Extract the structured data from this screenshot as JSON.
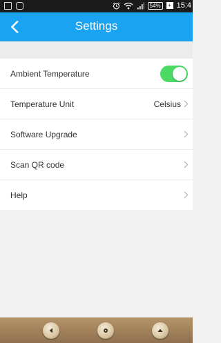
{
  "status_bar": {
    "battery": "54%",
    "time": "15:4"
  },
  "header": {
    "title": "Settings",
    "back_icon": "chevron-left-icon"
  },
  "settings": [
    {
      "label": "Ambient Temperature",
      "control": "toggle",
      "toggle_on": true
    },
    {
      "label": "Temperature Unit",
      "value": "Celsius",
      "control": "chevron"
    },
    {
      "label": "Software Upgrade",
      "control": "chevron"
    },
    {
      "label": "Scan QR code",
      "control": "chevron"
    },
    {
      "label": "Help",
      "control": "chevron"
    }
  ],
  "colors": {
    "accent": "#1aa3f0",
    "toggle_on": "#4cd964",
    "background": "#f2f2f2"
  }
}
